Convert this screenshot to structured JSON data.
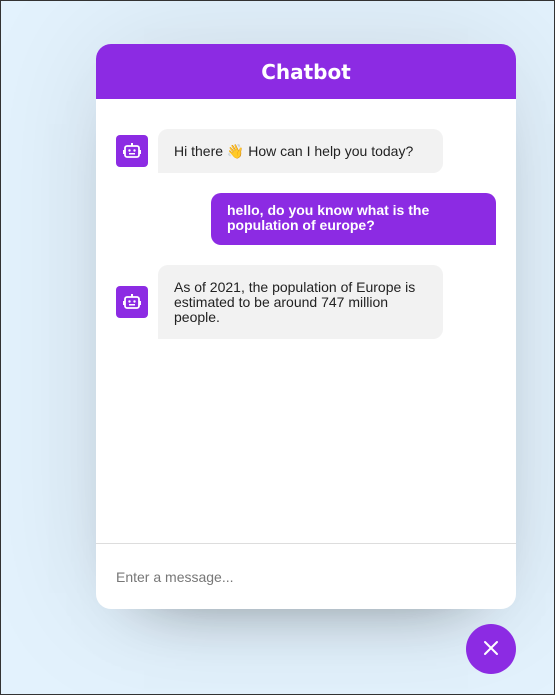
{
  "header": {
    "title": "Chatbot"
  },
  "messages": [
    {
      "role": "incoming",
      "text": "Hi there 👋 How can I help you today?"
    },
    {
      "role": "outgoing",
      "text": "hello, do you know what is the population of europe?"
    },
    {
      "role": "incoming",
      "text": "As of 2021, the population of Europe is estimated to be around 747 million people."
    }
  ],
  "input": {
    "placeholder": "Enter a message...",
    "value": ""
  },
  "icons": {
    "bot": "robot-icon",
    "toggler": "close-icon"
  },
  "colors": {
    "accent": "#8c2be3",
    "background": "#e3f2fd",
    "incoming_bubble": "#f2f2f2"
  }
}
